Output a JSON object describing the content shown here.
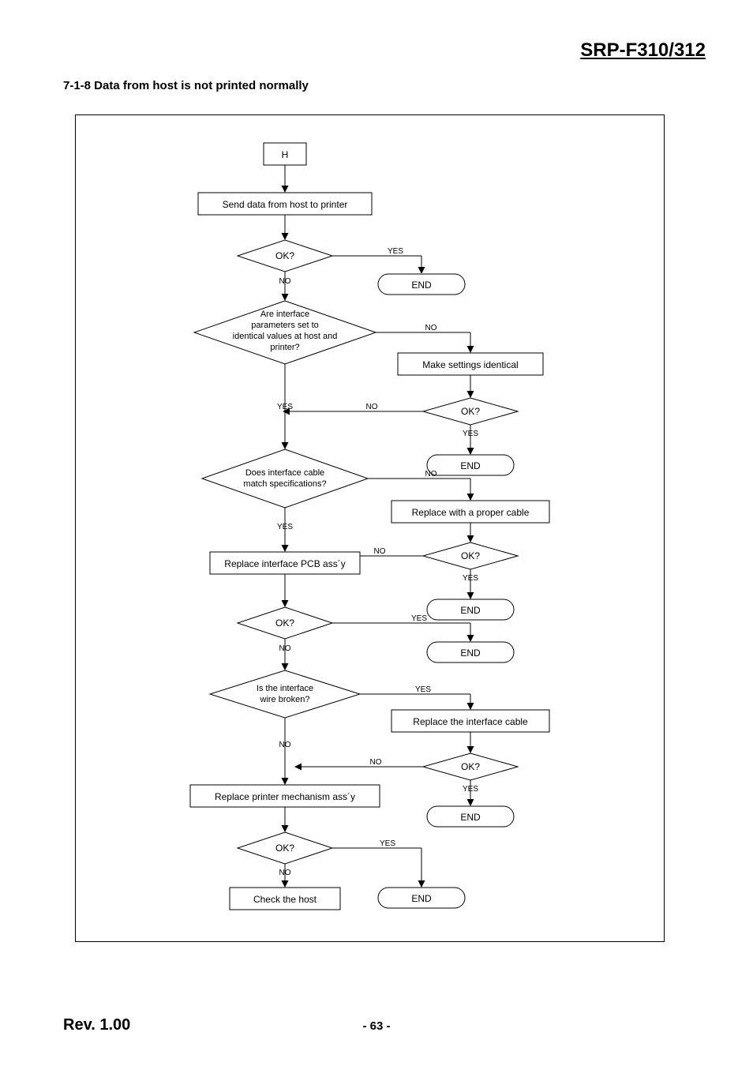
{
  "header": {
    "title": "SRP-F310/312"
  },
  "section": {
    "heading": "7-1-8 Data from host is not printed normally"
  },
  "footer": {
    "rev": "Rev. 1.00",
    "page": "- 63 -"
  },
  "labels": {
    "yes": "YES",
    "no": "NO"
  },
  "nodes": {
    "start": "H",
    "send": "Send data from host to printer",
    "ok1": "OK?",
    "end1": "END",
    "params": [
      "Are interface",
      "parameters set to",
      "identical values at host and",
      "printer?"
    ],
    "makeIdentical": "Make settings identical",
    "ok2": "OK?",
    "end2": "END",
    "cable": [
      "Does interface cable",
      "match specifications?"
    ],
    "replaceCable": "Replace with a proper cable",
    "ok3": "OK?",
    "replacePCB": "Replace interface PCB ass´y",
    "end3": "END",
    "ok4": "OK?",
    "end4": "END",
    "wire": [
      "Is the interface",
      "wire broken?"
    ],
    "replaceIface": "Replace the interface cable",
    "ok5": "OK?",
    "replaceMech": "Replace printer mechanism ass´y",
    "end5": "END",
    "ok6": "OK?",
    "end6": "END",
    "checkHost": "Check the host"
  }
}
